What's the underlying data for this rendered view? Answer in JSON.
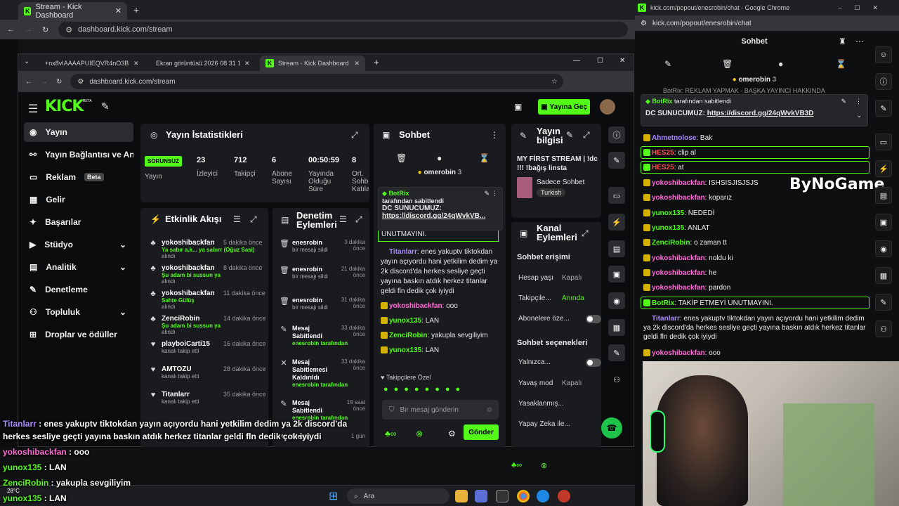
{
  "outer_tabs": {
    "active": "Stream - Kick Dashboard",
    "new": "+"
  },
  "outer_url": "dashboard.kick.com/stream",
  "inner_tabs": [
    "+nx8vIAAAAPUIEQVR4nO3BMQEAAADC",
    "Ekran görüntüsü 2026 08 31 17...",
    "Stream - Kick Dashboard"
  ],
  "inner_url": "dashboard.kick.com/stream",
  "header": {
    "logo": "KICK",
    "beta": "BETA",
    "go_live": "Yayına Geç"
  },
  "sidebar": [
    "Yayın",
    "Yayın Bağlantısı ve Anahtar",
    "Reklam",
    "Gelir",
    "Başarılar",
    "Stüdyo",
    "Analitik",
    "Denetleme",
    "Topluluk",
    "Droplar ve ödüller"
  ],
  "sidebar_beta": "Beta",
  "stats": {
    "title": "Yayın İstatistikleri",
    "status": "SORUNSUZ",
    "status_label": "Yayın",
    "items": [
      {
        "v": "23",
        "l": "İzleyici"
      },
      {
        "v": "712",
        "l": "Takipçi"
      },
      {
        "v": "6",
        "l": "Abone Sayısı"
      },
      {
        "v": "00:50:59",
        "l": "Yayında Olduğu Süre"
      },
      {
        "v": "8",
        "l": "Ort. Sohbet Katıla"
      }
    ]
  },
  "activity": {
    "title": "Etkinlik Akışı",
    "items": [
      {
        "u": "yokoshibackfan",
        "t": "5 dakika önce",
        "m": "Ya sabır a.k... ya sabırr (Oğuz Sasi)",
        "s": "alındı"
      },
      {
        "u": "yokoshibackfan",
        "t": "8 dakika önce",
        "m": "Şu adam bi sussun ya",
        "s": "alındı"
      },
      {
        "u": "yokoshibackfan",
        "t": "11 dakika önce",
        "m": "Sahte Gülüş",
        "s": "alındı"
      },
      {
        "u": "ZenciRobin",
        "t": "14 dakika önce",
        "m": "Şu adam bi sussun ya",
        "s": "alındı"
      },
      {
        "u": "playboiCarti15",
        "t": "16 dakika önce",
        "m": "",
        "s": "kanalı takip etti"
      },
      {
        "u": "AMTOZU",
        "t": "28 dakika önce",
        "m": "",
        "s": "kanalı takip etti"
      },
      {
        "u": "Titanlarr",
        "t": "35 dakika önce",
        "m": "",
        "s": "kanalı takip etti"
      }
    ]
  },
  "moderation": {
    "title": "Denetim Eylemleri",
    "items": [
      {
        "u": "enesrobin",
        "t": "3 dakika önce",
        "s": "bir mesajı sildi"
      },
      {
        "u": "enesrobin",
        "t": "21 dakika önce",
        "s": "bir mesajı sildi"
      },
      {
        "u": "enesrobin",
        "t": "31 dakika önce",
        "s": "bir mesajı sildi"
      },
      {
        "u": "Mesaj Sabitlendi",
        "t": "33 dakika önce",
        "s": "enesrobin tarafından"
      },
      {
        "u": "Mesaj Sabitlemesi Kaldırıldı",
        "t": "33 dakika önce",
        "s": "enesrobin tarafından"
      },
      {
        "u": "Mesaj Sabitlendi",
        "t": "19 saat önce",
        "s": "enesrobin tarafından"
      },
      {
        "u": "Mesaj",
        "t": "1 gün",
        "s": ""
      }
    ]
  },
  "chat": {
    "title": "Sohbet",
    "owner": "omerobin",
    "owner_count": "3",
    "pinned_user": "BotRix",
    "pinned_by": "tarafından sabitlendi",
    "pinned_text": "DC SUNUCUMUZ:",
    "pinned_link": "https://discord.gg/24qWvkVB...",
    "pinned_tail": "UNUTMAYINI.",
    "messages": [
      {
        "n": "Titanlarr",
        "c": "#a98bff",
        "t": ": enes yakuptv tiktokdan yayın açıyordu hani yetkilim dedim ya 2k discord'da herkes sesliye geçti yayına baskın atdık herkez titanlar geldi fln dedik çok iyiydi"
      },
      {
        "n": "yokoshibackfan",
        "c": "#ff6bd6",
        "t": ": ooo"
      },
      {
        "n": "yunox135",
        "c": "#53fc18",
        "t": ": LAN"
      },
      {
        "n": "ZenciRobin",
        "c": "#53fc18",
        "t": ": yakupla sevgiliyim"
      },
      {
        "n": "yunox135",
        "c": "#53fc18",
        "t": ": LAN"
      }
    ],
    "emote_label": "Takipçilere Özel",
    "placeholder": "Bir mesaj gönderin",
    "send": "Gönder"
  },
  "stream_info": {
    "title": "Yayın bilgisi",
    "stream_title": "MY FİRST STREAM | !dc !!! !bağış linsta",
    "category": "Sadece Sohbet",
    "tag": "Turkish"
  },
  "channel_actions": {
    "title": "Kanal Eylemleri",
    "access": "Sohbet erişimi",
    "rows": [
      {
        "l": "Hesap yaşı",
        "v": "Kapalı"
      },
      {
        "l": "Takipçile...",
        "v": "Anında"
      },
      {
        "l": "Abonelere öze...",
        "v": ""
      }
    ],
    "options": "Sohbet seçenekleri",
    "rows2": [
      {
        "l": "Yalnızca...",
        "v": ""
      },
      {
        "l": "Yavaş mod",
        "v": "Kapalı"
      },
      {
        "l": "Yasaklanmış...",
        "v": ""
      },
      {
        "l": "Yapay Zeka ile...",
        "v": ""
      }
    ]
  },
  "popout": {
    "title_bar": "kick.com/popout/enesrobin/chat - Google Chrome",
    "url": "kick.com/popout/enesrobin/chat",
    "title": "Sohbet",
    "owner": "omerobin",
    "owner_count": "3",
    "top_clip": "BotRix: REKLAM YAPMAK - BAŞKA YAYINCI HAKKINDA",
    "pinned_user": "BotRix",
    "pinned_by": "tarafından sabitlendi",
    "pinned_text": "DC SUNUCUMUZ:",
    "pinned_link": "https://discord.gg/24qWvkVB3D",
    "messages": [
      {
        "n": "Ahmetnolose",
        "c": "#a98bff",
        "t": ": Bak"
      },
      {
        "n": "HES25",
        "c": "#ff4d4d",
        "t": ": clip al",
        "hl": true
      },
      {
        "n": "HES25",
        "c": "#ff4d4d",
        "t": ": at",
        "hl": true
      },
      {
        "n": "yokoshibackfan",
        "c": "#ff6bd6",
        "t": ": ISHSISJISJSJS"
      },
      {
        "n": "yokoshibackfan",
        "c": "#ff6bd6",
        "t": ": koparız"
      },
      {
        "n": "yunox135",
        "c": "#53fc18",
        "t": ": NEDEDİ"
      },
      {
        "n": "yunox135",
        "c": "#53fc18",
        "t": ": ANLAT"
      },
      {
        "n": "ZenciRobin",
        "c": "#53fc18",
        "t": ": o zaman tt"
      },
      {
        "n": "yokoshibackfan",
        "c": "#ff6bd6",
        "t": ": noldu ki"
      },
      {
        "n": "yokoshibackfan",
        "c": "#ff6bd6",
        "t": ": he"
      },
      {
        "n": "yokoshibackfan",
        "c": "#ff6bd6",
        "t": ": pardon"
      },
      {
        "n": "BotRix",
        "c": "#53fc18",
        "t": ": TAKİP ETMEYİ UNUTMAYINI.",
        "hl": true
      },
      {
        "n": "Titanlarr",
        "c": "#a98bff",
        "t": ": enes yakuptv tiktokdan yayın açıyordu hani yetkilim dedim ya 2k discord'da herkes sesliye geçti yayına baskın atdık herkez titanlar geldi fln dedik çok iyiydi"
      },
      {
        "n": "yokoshibackfan",
        "c": "#ff6bd6",
        "t": ": ooo"
      }
    ]
  },
  "watermark": "ByNoGame",
  "overlay": [
    {
      "n": "Titanlarr",
      "c": "#a98bff",
      "t": " : enes yakuptv tiktokdan yayın açıyordu hani yetkilim dedim ya 2k discord'da"
    },
    {
      "n": "",
      "c": "#fff",
      "t": "herkes sesliye geçti yayına baskın atdık herkez titanlar geldi fln dedik çok iyiydi"
    },
    {
      "n": "yokoshibackfan",
      "c": "#ff6bd6",
      "t": " : ooo"
    },
    {
      "n": "yunox135",
      "c": "#53fc18",
      "t": " : LAN"
    },
    {
      "n": "ZenciRobin",
      "c": "#53fc18",
      "t": " : yakupla sevgiliyim"
    },
    {
      "n": "yunox135",
      "c": "#53fc18",
      "t": " : LAN"
    }
  ],
  "taskbar": {
    "search": "Ara",
    "temp": "28°C"
  }
}
